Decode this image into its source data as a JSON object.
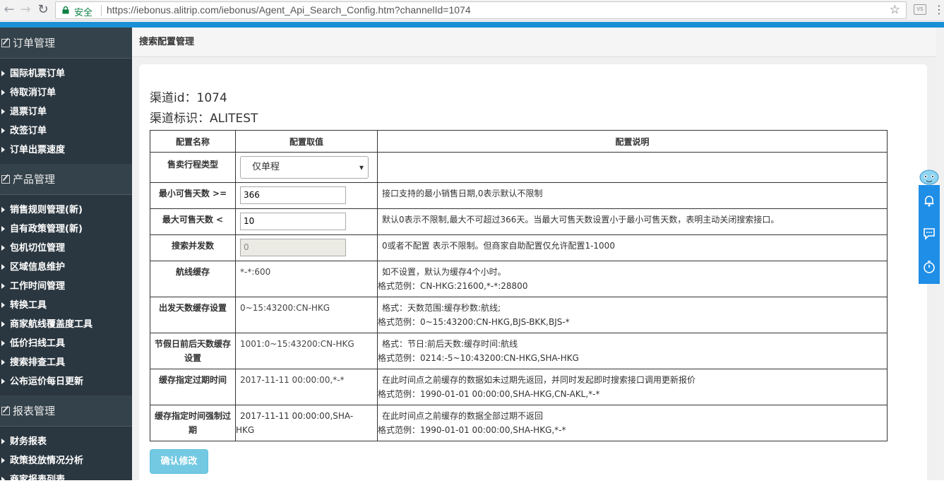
{
  "browser": {
    "secure_label": "安全",
    "url": "https://iebonus.alitrip.com/iebonus/Agent_Api_Search_Config.htm?channelId=1074",
    "ext_label": "VS"
  },
  "sidebar": {
    "sections": [
      {
        "title": "订单管理",
        "items": [
          "国际机票订单",
          "待取消订单",
          "退票订单",
          "改签订单",
          "订单出票速度"
        ]
      },
      {
        "title": "产品管理",
        "items": [
          "销售规则管理(新)",
          "自有政策管理(新)",
          "包机切位管理",
          "区域信息维护",
          "工作时间管理",
          "转换工具",
          "商家航线覆盖度工具",
          "低价扫线工具",
          "搜索排查工具",
          "公布运价每日更新"
        ]
      },
      {
        "title": "报表管理",
        "items": [
          "财务报表",
          "政策投放情况分析",
          "商家报表列表"
        ]
      }
    ]
  },
  "page": {
    "header": "搜索配置管理",
    "channel_id": "渠道id：1074",
    "channel_tag": "渠道标识：ALITEST",
    "submit_label": "确认修改"
  },
  "table": {
    "headers": [
      "配置名称",
      "配置取值",
      "配置说明"
    ],
    "rows": {
      "trip_type": {
        "name": "售卖行程类型",
        "value": "仅单程",
        "desc": ""
      },
      "min_days": {
        "name": "最小可售天数 >=",
        "value": "366",
        "desc": "接口支持的最小销售日期,0表示默认不限制"
      },
      "max_days": {
        "name": "最大可售天数 <",
        "value": "10",
        "desc": "默认0表示不限制,最大不可超过366天。当最大可售天数设置小于最小可售天数，表明主动关闭搜索接口。"
      },
      "concurrency": {
        "name": "搜索并发数",
        "value": "0",
        "desc": "0或者不配置 表示不限制。但商家自助配置仅允许配置1-1000"
      },
      "route_cache": {
        "name": "航线缓存",
        "value": "*-*:600",
        "desc1": "如不设置，默认为缓存4个小时。",
        "desc2": "格式范例：CN-HKG:21600,*-*:28800"
      },
      "depart_cache": {
        "name": "出发天数缓存设置",
        "value": "0~15:43200:CN-HKG",
        "desc1": "格式：天数范围:缓存秒数:航线;",
        "desc2": "格式范例：0~15:43200:CN-HKG,BJS-BKK,BJS-*"
      },
      "holiday_cache": {
        "name1": "节假日前后天数缓存",
        "name2": "设置",
        "value": "1001:0~15:43200:CN-HKG",
        "desc1": "格式：节日:前后天数:缓存时间:航线",
        "desc2": "格式范例：0214:-5~10:43200:CN-HKG,SHA-HKG"
      },
      "expire_cache": {
        "name": "缓存指定过期时间",
        "value": "2017-11-11 00:00:00,*-*",
        "desc1": "在此时间点之前缓存的数据如未过期先返回，并同时发起即时搜索接口调用更新报价",
        "desc2": "格式范例：1990-01-01 00:00:00,SHA-HKG,CN-AKL,*-*"
      },
      "force_expire": {
        "name1": "缓存指定时间强制过",
        "name2": "期",
        "value1": "2017-11-11 00:00:00,SHA-",
        "value2": "HKG",
        "desc1": "在此时间点之前缓存的数据全部过期不返回",
        "desc2": "格式范例：1990-01-01 00:00:00,SHA-HKG,*-*"
      }
    }
  },
  "colors": {
    "sidebar_bg": "#2b3740",
    "accent": "#1a8fd6",
    "button": "#5bc0de"
  }
}
